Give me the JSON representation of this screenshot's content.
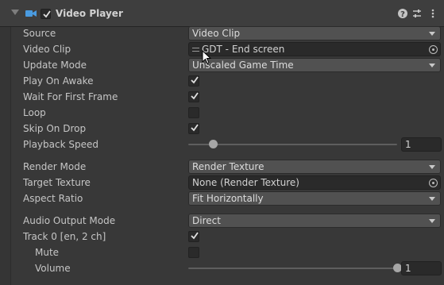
{
  "component": {
    "title": "Video Player",
    "icon": "video-camera-icon",
    "enabled": true,
    "header_icons": [
      "help-icon",
      "presets-sliders-icon",
      "kebab-menu-icon"
    ]
  },
  "fields": {
    "source": {
      "label": "Source",
      "value": "Video Clip"
    },
    "video_clip": {
      "label": "Video Clip",
      "value": "GDT - End screen"
    },
    "update_mode": {
      "label": "Update Mode",
      "value": "Unscaled Game Time"
    },
    "play_on_awake": {
      "label": "Play On Awake",
      "checked": true
    },
    "wait_first_frame": {
      "label": "Wait For First Frame",
      "checked": true
    },
    "loop": {
      "label": "Loop",
      "checked": false
    },
    "skip_on_drop": {
      "label": "Skip On Drop",
      "checked": true
    },
    "playback_speed": {
      "label": "Playback Speed",
      "value": "1",
      "slider_fraction": 0.12
    },
    "render_mode": {
      "label": "Render Mode",
      "value": "Render Texture"
    },
    "target_texture": {
      "label": "Target Texture",
      "value": "None (Render Texture)"
    },
    "aspect_ratio": {
      "label": "Aspect Ratio",
      "value": "Fit Horizontally"
    },
    "audio_output_mode": {
      "label": "Audio Output Mode",
      "value": "Direct"
    },
    "track0": {
      "label": "Track 0 [en, 2 ch]",
      "checked": true
    },
    "mute": {
      "label": "Mute",
      "checked": false
    },
    "volume": {
      "label": "Volume",
      "value": "1",
      "slider_fraction": 1.0
    }
  },
  "colors": {
    "background": "#383838",
    "header": "#3e3e3e",
    "dropdown": "#515151",
    "field": "#2a2a2a"
  }
}
